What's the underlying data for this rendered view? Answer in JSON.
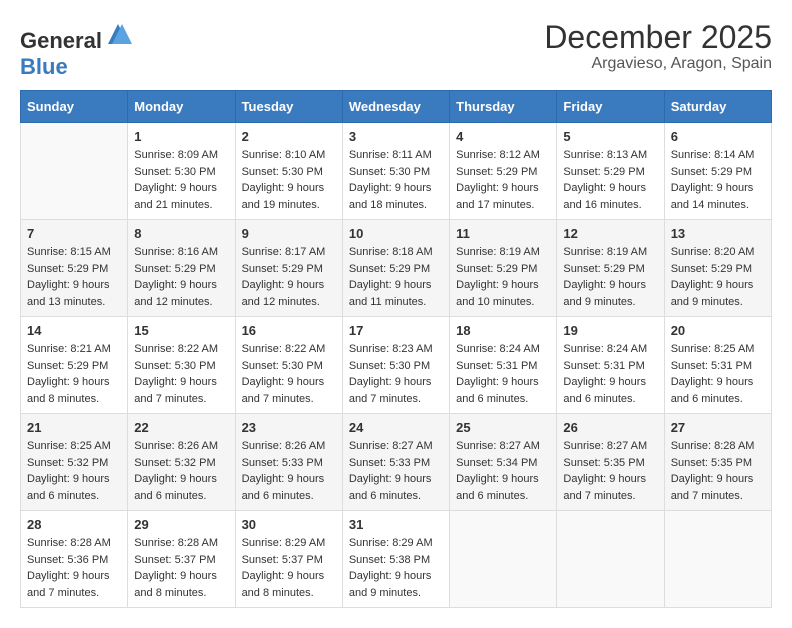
{
  "logo": {
    "general": "General",
    "blue": "Blue"
  },
  "title": "December 2025",
  "subtitle": "Argavieso, Aragon, Spain",
  "days_of_week": [
    "Sunday",
    "Monday",
    "Tuesday",
    "Wednesday",
    "Thursday",
    "Friday",
    "Saturday"
  ],
  "weeks": [
    [
      {
        "day": "",
        "sunrise": "",
        "sunset": "",
        "daylight": ""
      },
      {
        "day": "1",
        "sunrise": "Sunrise: 8:09 AM",
        "sunset": "Sunset: 5:30 PM",
        "daylight": "Daylight: 9 hours and 21 minutes."
      },
      {
        "day": "2",
        "sunrise": "Sunrise: 8:10 AM",
        "sunset": "Sunset: 5:30 PM",
        "daylight": "Daylight: 9 hours and 19 minutes."
      },
      {
        "day": "3",
        "sunrise": "Sunrise: 8:11 AM",
        "sunset": "Sunset: 5:30 PM",
        "daylight": "Daylight: 9 hours and 18 minutes."
      },
      {
        "day": "4",
        "sunrise": "Sunrise: 8:12 AM",
        "sunset": "Sunset: 5:29 PM",
        "daylight": "Daylight: 9 hours and 17 minutes."
      },
      {
        "day": "5",
        "sunrise": "Sunrise: 8:13 AM",
        "sunset": "Sunset: 5:29 PM",
        "daylight": "Daylight: 9 hours and 16 minutes."
      },
      {
        "day": "6",
        "sunrise": "Sunrise: 8:14 AM",
        "sunset": "Sunset: 5:29 PM",
        "daylight": "Daylight: 9 hours and 14 minutes."
      }
    ],
    [
      {
        "day": "7",
        "sunrise": "Sunrise: 8:15 AM",
        "sunset": "Sunset: 5:29 PM",
        "daylight": "Daylight: 9 hours and 13 minutes."
      },
      {
        "day": "8",
        "sunrise": "Sunrise: 8:16 AM",
        "sunset": "Sunset: 5:29 PM",
        "daylight": "Daylight: 9 hours and 12 minutes."
      },
      {
        "day": "9",
        "sunrise": "Sunrise: 8:17 AM",
        "sunset": "Sunset: 5:29 PM",
        "daylight": "Daylight: 9 hours and 12 minutes."
      },
      {
        "day": "10",
        "sunrise": "Sunrise: 8:18 AM",
        "sunset": "Sunset: 5:29 PM",
        "daylight": "Daylight: 9 hours and 11 minutes."
      },
      {
        "day": "11",
        "sunrise": "Sunrise: 8:19 AM",
        "sunset": "Sunset: 5:29 PM",
        "daylight": "Daylight: 9 hours and 10 minutes."
      },
      {
        "day": "12",
        "sunrise": "Sunrise: 8:19 AM",
        "sunset": "Sunset: 5:29 PM",
        "daylight": "Daylight: 9 hours and 9 minutes."
      },
      {
        "day": "13",
        "sunrise": "Sunrise: 8:20 AM",
        "sunset": "Sunset: 5:29 PM",
        "daylight": "Daylight: 9 hours and 9 minutes."
      }
    ],
    [
      {
        "day": "14",
        "sunrise": "Sunrise: 8:21 AM",
        "sunset": "Sunset: 5:29 PM",
        "daylight": "Daylight: 9 hours and 8 minutes."
      },
      {
        "day": "15",
        "sunrise": "Sunrise: 8:22 AM",
        "sunset": "Sunset: 5:30 PM",
        "daylight": "Daylight: 9 hours and 7 minutes."
      },
      {
        "day": "16",
        "sunrise": "Sunrise: 8:22 AM",
        "sunset": "Sunset: 5:30 PM",
        "daylight": "Daylight: 9 hours and 7 minutes."
      },
      {
        "day": "17",
        "sunrise": "Sunrise: 8:23 AM",
        "sunset": "Sunset: 5:30 PM",
        "daylight": "Daylight: 9 hours and 7 minutes."
      },
      {
        "day": "18",
        "sunrise": "Sunrise: 8:24 AM",
        "sunset": "Sunset: 5:31 PM",
        "daylight": "Daylight: 9 hours and 6 minutes."
      },
      {
        "day": "19",
        "sunrise": "Sunrise: 8:24 AM",
        "sunset": "Sunset: 5:31 PM",
        "daylight": "Daylight: 9 hours and 6 minutes."
      },
      {
        "day": "20",
        "sunrise": "Sunrise: 8:25 AM",
        "sunset": "Sunset: 5:31 PM",
        "daylight": "Daylight: 9 hours and 6 minutes."
      }
    ],
    [
      {
        "day": "21",
        "sunrise": "Sunrise: 8:25 AM",
        "sunset": "Sunset: 5:32 PM",
        "daylight": "Daylight: 9 hours and 6 minutes."
      },
      {
        "day": "22",
        "sunrise": "Sunrise: 8:26 AM",
        "sunset": "Sunset: 5:32 PM",
        "daylight": "Daylight: 9 hours and 6 minutes."
      },
      {
        "day": "23",
        "sunrise": "Sunrise: 8:26 AM",
        "sunset": "Sunset: 5:33 PM",
        "daylight": "Daylight: 9 hours and 6 minutes."
      },
      {
        "day": "24",
        "sunrise": "Sunrise: 8:27 AM",
        "sunset": "Sunset: 5:33 PM",
        "daylight": "Daylight: 9 hours and 6 minutes."
      },
      {
        "day": "25",
        "sunrise": "Sunrise: 8:27 AM",
        "sunset": "Sunset: 5:34 PM",
        "daylight": "Daylight: 9 hours and 6 minutes."
      },
      {
        "day": "26",
        "sunrise": "Sunrise: 8:27 AM",
        "sunset": "Sunset: 5:35 PM",
        "daylight": "Daylight: 9 hours and 7 minutes."
      },
      {
        "day": "27",
        "sunrise": "Sunrise: 8:28 AM",
        "sunset": "Sunset: 5:35 PM",
        "daylight": "Daylight: 9 hours and 7 minutes."
      }
    ],
    [
      {
        "day": "28",
        "sunrise": "Sunrise: 8:28 AM",
        "sunset": "Sunset: 5:36 PM",
        "daylight": "Daylight: 9 hours and 7 minutes."
      },
      {
        "day": "29",
        "sunrise": "Sunrise: 8:28 AM",
        "sunset": "Sunset: 5:37 PM",
        "daylight": "Daylight: 9 hours and 8 minutes."
      },
      {
        "day": "30",
        "sunrise": "Sunrise: 8:29 AM",
        "sunset": "Sunset: 5:37 PM",
        "daylight": "Daylight: 9 hours and 8 minutes."
      },
      {
        "day": "31",
        "sunrise": "Sunrise: 8:29 AM",
        "sunset": "Sunset: 5:38 PM",
        "daylight": "Daylight: 9 hours and 9 minutes."
      },
      {
        "day": "",
        "sunrise": "",
        "sunset": "",
        "daylight": ""
      },
      {
        "day": "",
        "sunrise": "",
        "sunset": "",
        "daylight": ""
      },
      {
        "day": "",
        "sunrise": "",
        "sunset": "",
        "daylight": ""
      }
    ]
  ]
}
